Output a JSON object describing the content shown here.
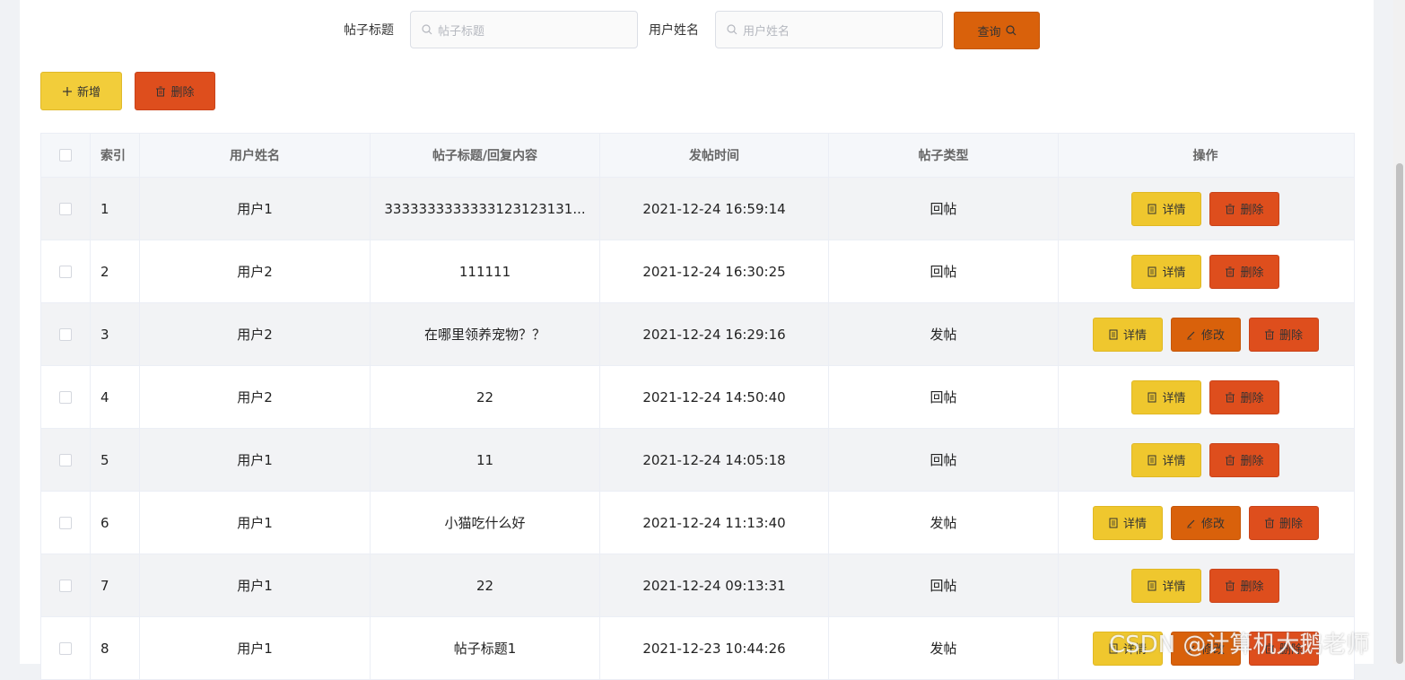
{
  "search": {
    "title_label": "帖子标题",
    "title_placeholder": "帖子标题",
    "user_label": "用户姓名",
    "user_placeholder": "用户姓名",
    "query_button": "查询"
  },
  "toolbar": {
    "add_label": "新增",
    "delete_label": "删除"
  },
  "table": {
    "columns": [
      "索引",
      "用户姓名",
      "帖子标题/回复内容",
      "发帖时间",
      "帖子类型",
      "操作"
    ],
    "action_labels": {
      "detail": "详情",
      "edit": "修改",
      "delete": "删除"
    },
    "rows": [
      {
        "index": "1",
        "user": "用户1",
        "title": "3333333333333123123131...",
        "time": "2021-12-24 16:59:14",
        "type": "回帖",
        "actions": [
          "detail",
          "delete"
        ]
      },
      {
        "index": "2",
        "user": "用户2",
        "title": "111111",
        "time": "2021-12-24 16:30:25",
        "type": "回帖",
        "actions": [
          "detail",
          "delete"
        ]
      },
      {
        "index": "3",
        "user": "用户2",
        "title": "在哪里领养宠物？？",
        "time": "2021-12-24 16:29:16",
        "type": "发帖",
        "actions": [
          "detail",
          "edit",
          "delete"
        ]
      },
      {
        "index": "4",
        "user": "用户2",
        "title": "22",
        "time": "2021-12-24 14:50:40",
        "type": "回帖",
        "actions": [
          "detail",
          "delete"
        ]
      },
      {
        "index": "5",
        "user": "用户1",
        "title": "11",
        "time": "2021-12-24 14:05:18",
        "type": "回帖",
        "actions": [
          "detail",
          "delete"
        ]
      },
      {
        "index": "6",
        "user": "用户1",
        "title": "小猫吃什么好",
        "time": "2021-12-24 11:13:40",
        "type": "发帖",
        "actions": [
          "detail",
          "edit",
          "delete"
        ]
      },
      {
        "index": "7",
        "user": "用户1",
        "title": "22",
        "time": "2021-12-24 09:13:31",
        "type": "回帖",
        "actions": [
          "detail",
          "delete"
        ]
      },
      {
        "index": "8",
        "user": "用户1",
        "title": "帖子标题1",
        "time": "2021-12-23 10:44:26",
        "type": "发帖",
        "actions": [
          "detail",
          "edit",
          "delete"
        ]
      }
    ]
  },
  "watermark": "CSDN @计算机大鹅老师",
  "colors": {
    "query": "#d9610b",
    "add": "#f2cd3a",
    "delete": "#de4e1d",
    "detail": "#efc72e",
    "edit": "#d9610b"
  },
  "icons": {
    "search": "magnifier-icon",
    "add": "plus-icon",
    "delete": "trash-icon",
    "detail": "document-icon",
    "edit": "pencil-icon"
  }
}
